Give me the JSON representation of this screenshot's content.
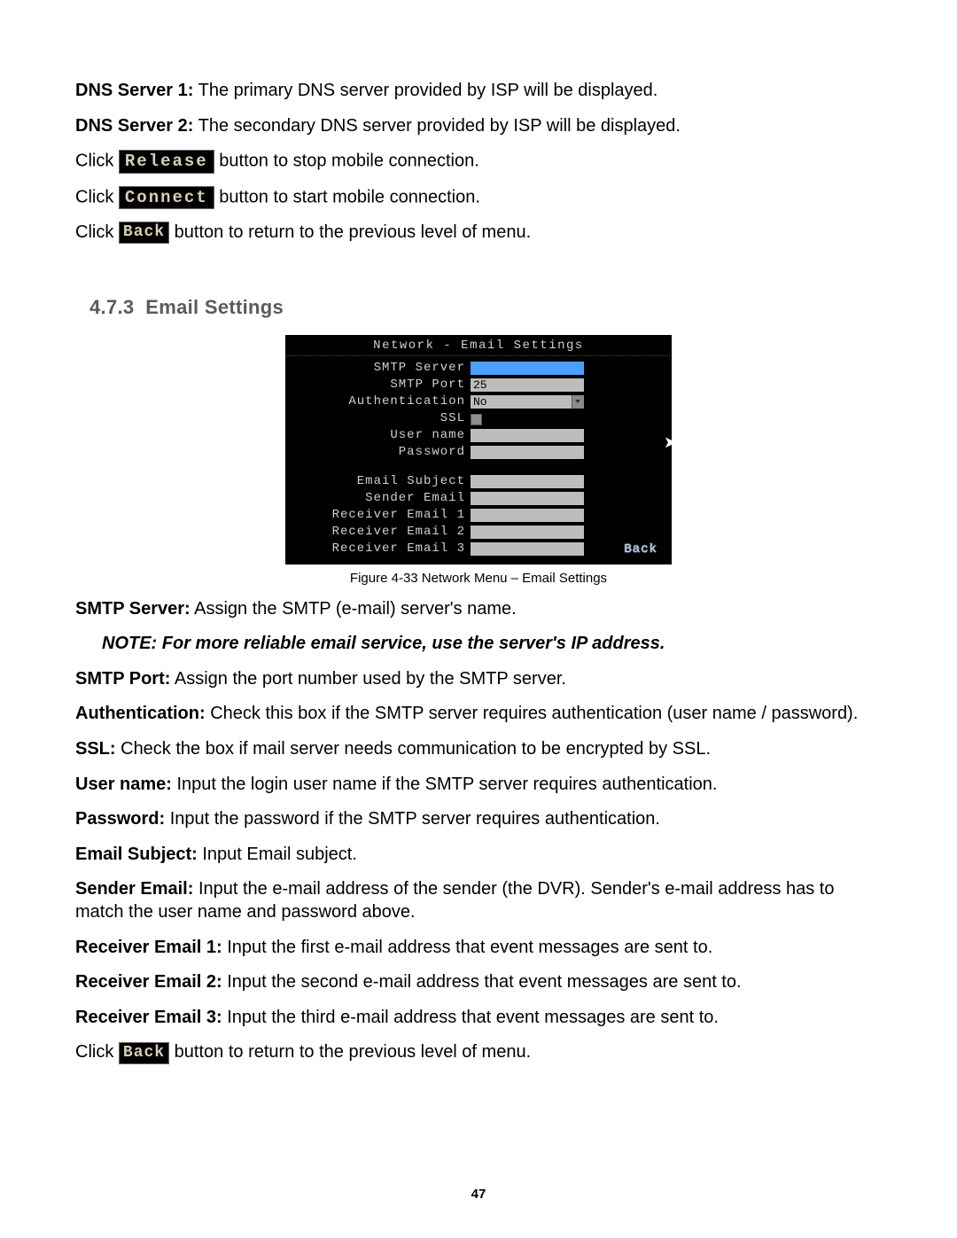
{
  "dns1": {
    "label": "DNS Server 1:",
    "text": " The primary DNS server provided by ISP will be displayed."
  },
  "dns2": {
    "label": "DNS Server 2:",
    "text": " The secondary DNS server provided by ISP will be displayed."
  },
  "release": {
    "pre": "Click ",
    "btn": "Release",
    "post": " button to stop mobile connection."
  },
  "connect": {
    "pre": "Click ",
    "btn": "Connect",
    "post": " button to start mobile connection."
  },
  "back1": {
    "pre": "Click ",
    "btn": "Back",
    "post": " button to return to the previous level of menu."
  },
  "heading": {
    "num": "4.7.3",
    "title": "Email Settings"
  },
  "screenshot": {
    "title": "Network - Email Settings",
    "rows": {
      "smtp_server": {
        "label": "SMTP Server",
        "value": ""
      },
      "smtp_port": {
        "label": "SMTP Port",
        "value": "25"
      },
      "auth": {
        "label": "Authentication",
        "value": "No"
      },
      "ssl": {
        "label": "SSL"
      },
      "user_name": {
        "label": "User name",
        "value": ""
      },
      "password": {
        "label": "Password",
        "value": ""
      },
      "subject": {
        "label": "Email Subject",
        "value": ""
      },
      "sender": {
        "label": "Sender Email",
        "value": ""
      },
      "rx1": {
        "label": "Receiver Email 1",
        "value": ""
      },
      "rx2": {
        "label": "Receiver Email 2",
        "value": ""
      },
      "rx3": {
        "label": "Receiver Email 3",
        "value": ""
      }
    },
    "back": "Back"
  },
  "caption": "Figure 4-33  Network Menu – Email Settings",
  "defs": {
    "smtp_server": {
      "label": "SMTP Server:",
      "text": " Assign the SMTP (e-mail) server's name."
    },
    "note": "NOTE: For more reliable email service, use the server's IP address.",
    "smtp_port": {
      "label": "SMTP Port:",
      "text": " Assign the port number used by the SMTP server."
    },
    "auth": {
      "label": "Authentication:",
      "text": " Check this box if the SMTP server requires authentication (user name / password)."
    },
    "ssl": {
      "label": "SSL:",
      "text": " Check the box if mail server needs communication to be encrypted by SSL."
    },
    "user": {
      "label": "User name:",
      "text": " Input the login user name if the SMTP server requires authentication."
    },
    "pass": {
      "label": "Password:",
      "text": " Input the password if the SMTP server requires authentication."
    },
    "subject": {
      "label": "Email Subject:",
      "text": " Input Email subject."
    },
    "sender": {
      "label": "Sender Email:",
      "text": " Input the e-mail address of the sender (the DVR). Sender's e-mail address has to match the user name and password above."
    },
    "rx1": {
      "label": "Receiver Email 1:",
      "text": " Input the first e-mail address that event messages are sent to."
    },
    "rx2": {
      "label": "Receiver Email 2:",
      "text": " Input the second e-mail address that event messages are sent to."
    },
    "rx3": {
      "label": "Receiver Email 3:",
      "text": " Input the third e-mail address that event messages are sent to."
    }
  },
  "back2": {
    "pre": "Click ",
    "btn": "Back",
    "post": " button to return to the previous level of menu."
  },
  "page_number": "47"
}
